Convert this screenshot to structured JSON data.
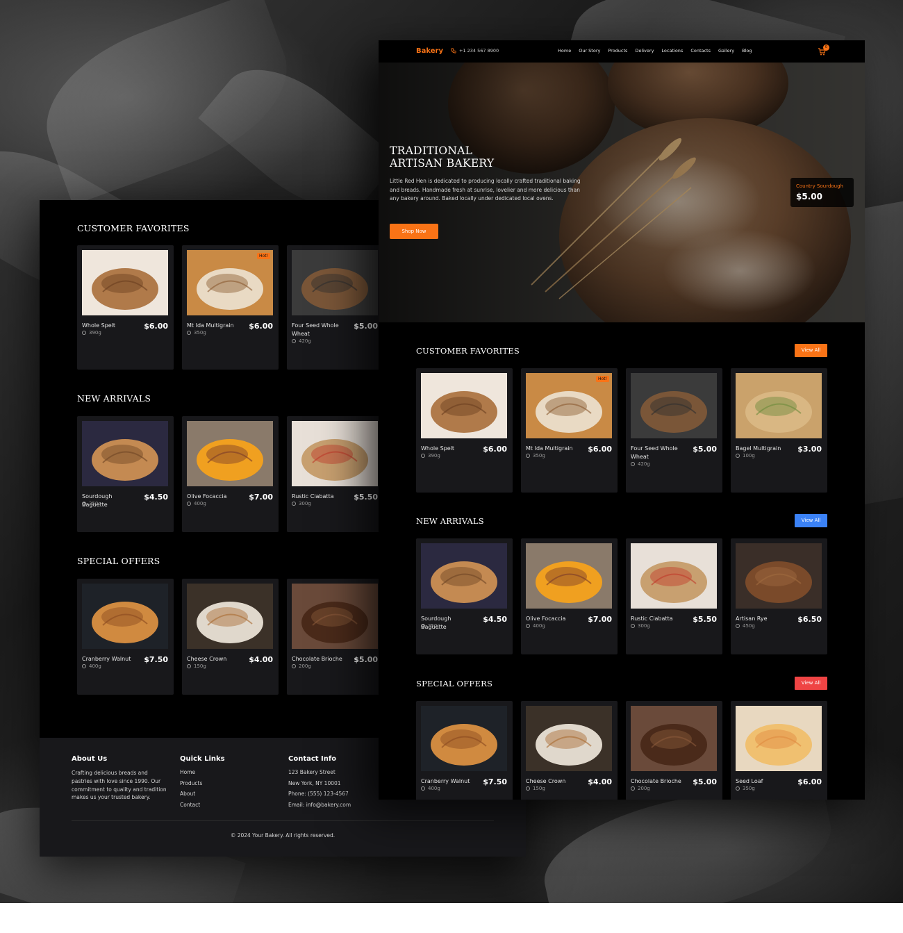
{
  "colors": {
    "accent": "#f97316",
    "blue": "#3b82f6",
    "red": "#ef4444",
    "card": "#18181b"
  },
  "nav": {
    "logo": "Bakery",
    "phone": "+1 234 567 8900",
    "menu": [
      "Home",
      "Our Story",
      "Products",
      "Delivery",
      "Locations",
      "Contacts",
      "Gallery",
      "Blog"
    ],
    "cart_count": "0"
  },
  "hero": {
    "title_line1": "TRADITIONAL",
    "title_line2": "ARTISAN BAKERY",
    "description": "Little Red Hen is dedicated to producing locally crafted traditional baking and breads. Handmade fresh at sunrise, lovelier and more delicious than any bakery around. Baked locally under dedicated local ovens.",
    "cta": "Shop Now",
    "featured_name": "Country Sourdough",
    "featured_price": "$5.00"
  },
  "sections": {
    "favorites": {
      "title": "CUSTOMER FAVORITES",
      "view_all": "View All",
      "items": [
        {
          "name": "Whole Spelt",
          "price": "$6.00",
          "weight": "390g"
        },
        {
          "name": "Mt Ida Multigrain",
          "price": "$6.00",
          "weight": "350g",
          "badge": "Hot!"
        },
        {
          "name": "Four Seed Whole Wheat",
          "price": "$5.00",
          "weight": "420g"
        },
        {
          "name": "Bagel Multigrain",
          "price": "$3.00",
          "weight": "100g"
        }
      ]
    },
    "arrivals": {
      "title": "NEW ARRIVALS",
      "view_all": "View All",
      "items": [
        {
          "name": "Sourdough Baguette",
          "price": "$4.50",
          "weight": "250g"
        },
        {
          "name": "Olive Focaccia",
          "price": "$7.00",
          "weight": "400g"
        },
        {
          "name": "Rustic Ciabatta",
          "price": "$5.50",
          "weight": "300g"
        },
        {
          "name": "Artisan Rye",
          "price": "$6.50",
          "weight": "450g"
        }
      ]
    },
    "offers": {
      "title": "SPECIAL OFFERS",
      "view_all": "View All",
      "items": [
        {
          "name": "Cranberry Walnut",
          "price": "$7.50",
          "weight": "400g"
        },
        {
          "name": "Cheese Crown",
          "price": "$4.00",
          "weight": "150g"
        },
        {
          "name": "Chocolate Brioche",
          "price": "$5.00",
          "weight": "200g"
        },
        {
          "name": "Seed Loaf",
          "price": "$6.00",
          "weight": "350g"
        }
      ]
    }
  },
  "footer": {
    "about_title": "About Us",
    "about_text": "Crafting delicious breads and pastries with love since 1990. Our commitment to quality and tradition makes us your trusted bakery.",
    "links_title": "Quick Links",
    "links": [
      "Home",
      "Products",
      "About",
      "Contact"
    ],
    "contact_title": "Contact Info",
    "contact": [
      "123 Bakery Street",
      "New York, NY 10001",
      "Phone: (555) 123-4567",
      "Email: info@bakery.com"
    ],
    "copyright": "© 2024 Your Bakery. All rights reserved."
  }
}
